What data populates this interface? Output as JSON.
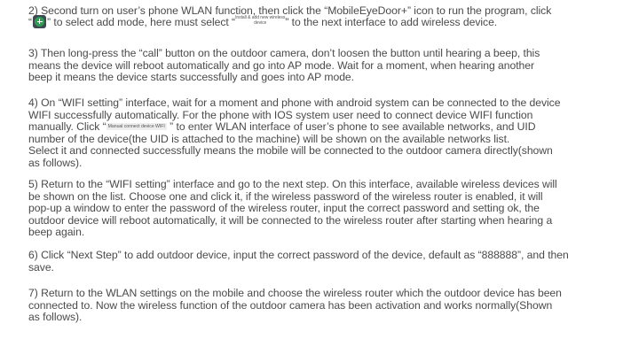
{
  "steps": [
    {
      "id": "step-2",
      "lines": [
        [
          "2) Second turn on user’s phone WLAN function, then click the “MobileEyeDoor+” icon to run the program, click"
        ],
        [
          "“",
          "[icon]",
          "” to select add mode, here must select “",
          "[btn]",
          "” to the next interface to add wireless device."
        ]
      ],
      "line1": "2) Second turn on user’s phone WLAN function, then click the “MobileEyeDoor+” icon to run the program, click",
      "line2_a": "“",
      "line2_b": "” to select add mode, here must select “",
      "line2_c": "” to the next interface to add wireless device.",
      "add_icon": "plus-circle-icon",
      "install_button_line1": "Install & add new wireless",
      "install_button_line2": "device"
    },
    {
      "id": "step-3",
      "line1": "3) Then long-press the “call” button on the outdoor camera, don’t loosen the button until hearing a beep, this",
      "line2": "means the device will reboot automatically and go into AP mode. Wait for a moment, when hearing another",
      "line3": "beep it means the device starts successfully and goes into AP mode."
    },
    {
      "id": "step-4",
      "line1": "4) On “WIFI setting” interface, wait for a moment and phone with android system can be connected to the device",
      "line2": "WIFI successfully automatically. For the phone with IOS system user need to connect device WIFI function",
      "line3_a": "manually. Click “",
      "line3_btn": "Manual connect device WIFI",
      "line3_b": " ” to enter WLAN interface of user’s phone to see available networks, and UID",
      "line4": "number of the device(the UID is attached to the machine) will be shown on the available networks list.",
      "line5": "Select it and connected successfully means the mobile will be connected to the outdoor camera directly(shown",
      "line6": "as follows)."
    },
    {
      "id": "step-5",
      "line1": "5) Return to the “WIFI setting” interface and go to the next step. On this interface, available wireless devices will",
      "line2": "be shown on the list. Choose one and click it, if the wireless password of the wireless router is enabled, it will",
      "line3": "pop-up a window to enter the password of the wireless router, input the correct password and setting ok, the",
      "line4": "outdoor device will reboot automatically, it will be connected to the wireless router after starting when hearing a",
      "line5": "beep again."
    },
    {
      "id": "step-6",
      "line1": "6) Click “Next Step” to add outdoor device, input the correct password of the device, default as “888888”, and then",
      "line2": "save."
    },
    {
      "id": "step-7",
      "line1": "7) Return to the WLAN settings on the mobile and choose the wireless router which the outdoor device has been",
      "line2": "connected to. Now the wireless function of the outdoor camera has been activation and works normally(Shown",
      "line3": "as follows)."
    }
  ]
}
